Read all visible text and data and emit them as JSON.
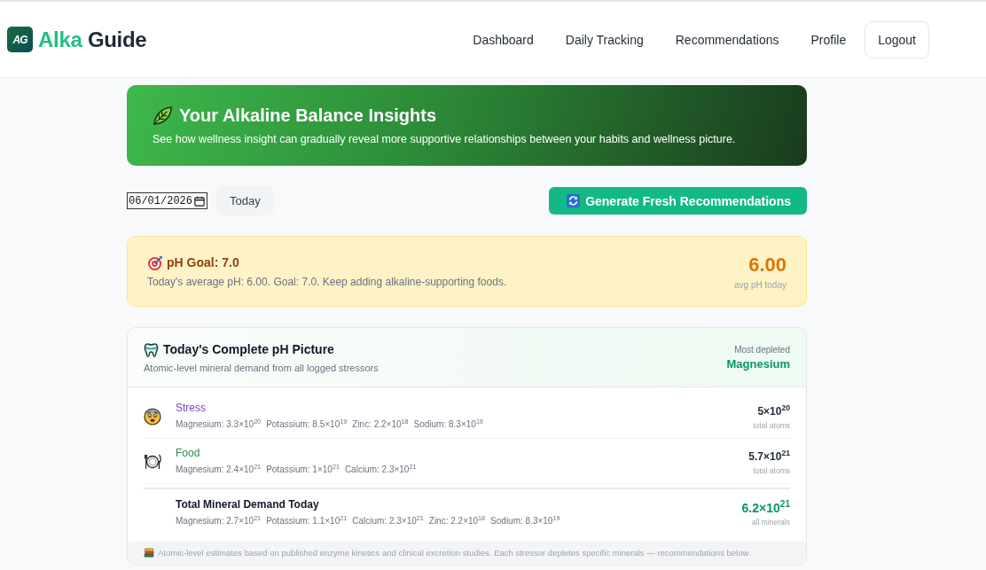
{
  "header": {
    "logo_mark": "AG",
    "brand_words": [
      "Alka",
      "Guide"
    ],
    "nav": [
      {
        "label": "Dashboard",
        "selected": false
      },
      {
        "label": "Daily Tracking",
        "selected": false
      },
      {
        "label": "Recommendations",
        "selected": false
      },
      {
        "label": "Profile",
        "selected": false
      }
    ],
    "logout": "Logout"
  },
  "hero": {
    "title": "Your Alkaline Balance Insights",
    "subtitle": "See how wellness insight can gradually reveal more supportive relationships between your habits and wellness picture."
  },
  "controls": {
    "date": "06/01/2026",
    "today": "Today",
    "generate": "Generate Fresh Recommendations"
  },
  "goal_card": {
    "title": "pH Goal: 7.0",
    "message": "Today's average pH: 6.00. Goal: 7.0. Keep adding alkaline-supporting foods.",
    "value": "6.00",
    "value_label": "avg pH today"
  },
  "ph_picture": {
    "title": "Today's Complete pH Picture",
    "subtitle": "Atomic-level mineral demand from all logged stressors",
    "depleted_label": "Most depleted",
    "depleted_mineral": "Magnesium",
    "stressors": [
      {
        "kind": "stress",
        "name": "Stress",
        "color": "#7e45c9",
        "minerals": [
          "Magnesium: 3.3×10$^{20}$",
          "Potassium: 8.5×10$^{19}$",
          "Zinc: 2.2×10$^{18}$",
          "Sodium: 8.3×10$^{19}$"
        ],
        "total": "5×10$^{20}$",
        "total_label": "total atoms"
      },
      {
        "kind": "food",
        "name": "Food",
        "color": "#2f8a47",
        "minerals": [
          "Magnesium: 2.4×10$^{21}$",
          "Potassium: 1×10$^{21}$",
          "Calcium: 2.3×10$^{21}$"
        ],
        "total": "5.7×10$^{21}$",
        "total_label": "total atoms"
      }
    ],
    "summary": {
      "title": "Total Mineral Demand Today",
      "minerals": [
        "Magnesium: 2.7×10$^{21}$",
        "Potassium: 1.1×10$^{21}$",
        "Calcium: 2.3×10$^{21}$",
        "Zinc: 2.2×10$^{18}$",
        "Sodium: 8.3×10$^{19}$"
      ],
      "total": "6.2×10$^{21}$",
      "total_label": "all minerals"
    },
    "footnote": "Atomic-level estimates based on published enzyme kinetics and clinical excretion studies. Each stressor depletes specific minerals — recommendations below"
  }
}
